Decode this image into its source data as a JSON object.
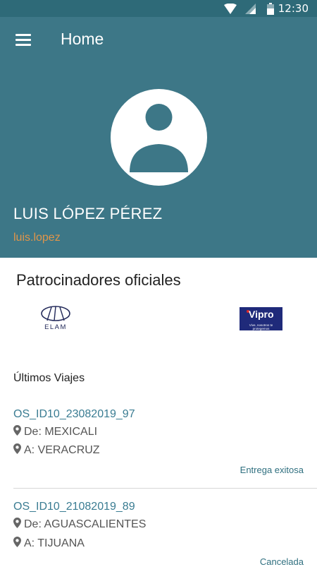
{
  "status_bar": {
    "time": "12:30",
    "icons": [
      "wifi-icon",
      "signal-icon",
      "battery-icon"
    ]
  },
  "app_bar": {
    "title": "Home",
    "menu_icon": "hamburger-menu-icon"
  },
  "profile": {
    "name": "LUIS LÓPEZ PÉREZ",
    "username": "luis.lopez",
    "avatar_icon": "user-avatar-icon"
  },
  "sponsors": {
    "title": "Patrocinadores oficiales",
    "logos": [
      {
        "name": "ELAM",
        "text": "ELAM"
      },
      {
        "name": "Vipro",
        "text": "Vipro",
        "tagline": "Vive, nosotros te protegemos"
      }
    ]
  },
  "trips": {
    "title": "Últimos Viajes",
    "items": [
      {
        "id": "OS_ID10_23082019_97",
        "from": "De: MEXICALI",
        "to": "A: VERACRUZ",
        "status": "Entrega exitosa"
      },
      {
        "id": "OS_ID10_21082019_89",
        "from": "De: AGUASCALIENTES",
        "to": "A: TIJUANA",
        "status": "Cancelada"
      }
    ]
  },
  "colors": {
    "header": "#3d7787",
    "status_bar": "#2e6a78",
    "username": "#e0954a",
    "link": "#3a7c92",
    "vipro_brand": "#1f2a7a"
  }
}
